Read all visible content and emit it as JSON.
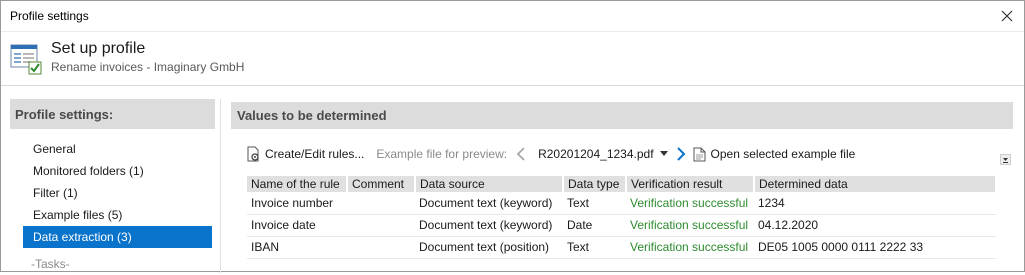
{
  "window": {
    "title": "Profile settings",
    "close_icon": "close-icon"
  },
  "header": {
    "title": "Set up profile",
    "subtitle": "Rename invoices - Imaginary GmbH",
    "icon": "profile-settings-icon"
  },
  "sidebar": {
    "heading": "Profile settings:",
    "items": [
      {
        "label": "General"
      },
      {
        "label": "Monitored folders (1)"
      },
      {
        "label": "Filter (1)"
      },
      {
        "label": "Example files (5)"
      },
      {
        "label": "Data extraction (3)",
        "active": true
      }
    ],
    "tasks_label": "-Tasks-"
  },
  "main": {
    "heading": "Values to be determined",
    "toolbar": {
      "create_edit_label": "Create/Edit rules...",
      "example_file_label": "Example file for preview:",
      "example_file_value": "R20201204_1234.pdf",
      "open_example_label": "Open selected example file"
    },
    "table": {
      "columns": [
        "Name of the rule",
        "Comment",
        "Data source",
        "Data type",
        "Verification result",
        "Determined data"
      ],
      "rows": [
        {
          "name": "Invoice number",
          "comment": "",
          "source": "Document text (keyword)",
          "type": "Text",
          "result": "Verification successful",
          "data": "1234"
        },
        {
          "name": "Invoice date",
          "comment": "",
          "source": "Document text (keyword)",
          "type": "Date",
          "result": "Verification successful",
          "data": "04.12.2020"
        },
        {
          "name": "IBAN",
          "comment": "",
          "source": "Document text (position)",
          "type": "Text",
          "result": "Verification successful",
          "data": "DE05 1005 0000 0111 2222 33"
        }
      ]
    }
  },
  "colors": {
    "accent": "#0a73cb",
    "success": "#2e8b2e",
    "panel_header": "#dcdcdc"
  }
}
